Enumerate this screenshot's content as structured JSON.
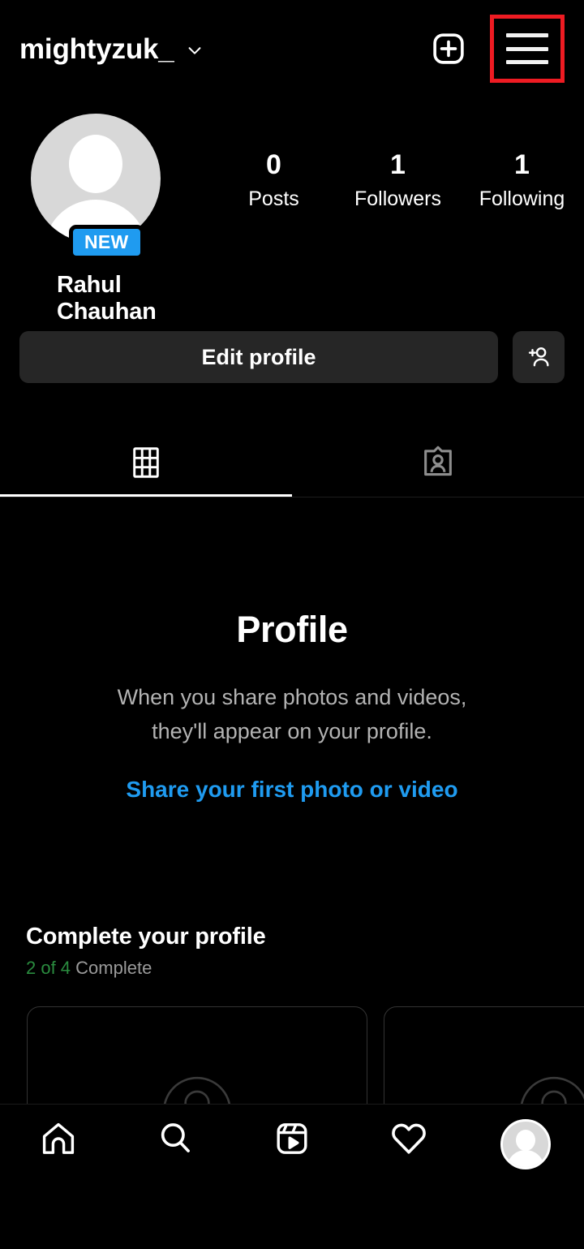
{
  "header": {
    "username": "mightyzuk_",
    "chevron_icon": "chevron-down-icon",
    "create_icon": "plus-square-icon",
    "menu_icon": "hamburger-menu-icon",
    "highlight_color": "#ee1b22"
  },
  "profile": {
    "avatar_icon": "default-avatar-icon",
    "badge": "NEW",
    "badge_color": "#1f9bf0",
    "display_name": "Rahul Chauhan",
    "stats": [
      {
        "value": "0",
        "label": "Posts"
      },
      {
        "value": "1",
        "label": "Followers"
      },
      {
        "value": "1",
        "label": "Following"
      }
    ]
  },
  "actions": {
    "edit_profile_label": "Edit profile",
    "add_person_icon": "add-person-icon"
  },
  "tabs": [
    {
      "id": "grid",
      "icon": "grid-icon",
      "active": true
    },
    {
      "id": "tagged",
      "icon": "tagged-person-icon",
      "active": false
    }
  ],
  "empty_state": {
    "title": "Profile",
    "description_line1": "When you share photos and videos,",
    "description_line2": "they'll appear on your profile.",
    "link_label": "Share your first photo or video",
    "link_color": "#1f9bf0"
  },
  "complete_profile": {
    "title": "Complete your profile",
    "progress_count": "2 of 4",
    "progress_word": "Complete",
    "progress_color": "#2a8c3f",
    "cards": [
      {
        "icon": "person-circle-outline-icon"
      },
      {
        "icon": "person-circle-outline-icon"
      }
    ]
  },
  "bottom_nav": [
    {
      "id": "home",
      "icon": "home-icon",
      "active": false
    },
    {
      "id": "search",
      "icon": "search-icon",
      "active": false
    },
    {
      "id": "reels",
      "icon": "reels-icon",
      "active": false
    },
    {
      "id": "activity",
      "icon": "heart-icon",
      "active": false
    },
    {
      "id": "profile",
      "icon": "profile-avatar-icon",
      "active": true
    }
  ]
}
